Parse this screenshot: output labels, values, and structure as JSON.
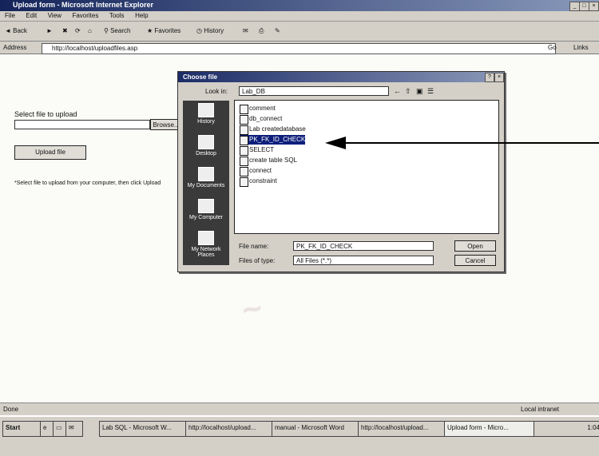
{
  "window": {
    "title": "Upload form - Microsoft Internet Explorer"
  },
  "menu": [
    "File",
    "Edit",
    "View",
    "Favorites",
    "Tools",
    "Help"
  ],
  "toolbar": {
    "back": "Back",
    "search": "Search",
    "favorites": "Favorites",
    "history": "History"
  },
  "address": {
    "label": "Address",
    "value": "http://localhost/uploadfiles.asp",
    "go": "Go",
    "links": "Links"
  },
  "page": {
    "select_label": "Select file to upload",
    "browse": "Browse...",
    "upload_button": "Upload file",
    "note": "*Select file to upload from your computer, then click Upload"
  },
  "dialog": {
    "title": "Choose file",
    "lookin_label": "Look in:",
    "lookin_value": "Lab_DB",
    "places": [
      "History",
      "Desktop",
      "My Documents",
      "My Computer",
      "My Network Places"
    ],
    "files": [
      "comment",
      "db_connect",
      "Lab createdatabase",
      "PK_FK_ID_CHECK",
      "SELECT",
      "create table SQL",
      "connect",
      "constraint"
    ],
    "filename_label": "File name:",
    "filename_value": "PK_FK_ID_CHECK",
    "filetype_label": "Files of type:",
    "filetype_value": "All Files (*.*)",
    "open": "Open",
    "cancel": "Cancel"
  },
  "status": {
    "left": "Done",
    "right": "Local intranet"
  },
  "taskbar": {
    "start": "Start",
    "tasks": [
      "Lab SQL - Microsoft W...",
      "http://localhost/upload...",
      "manual - Microsoft Word",
      "http://localhost/upload...",
      "Upload form - Micro..."
    ],
    "clock": "1:04"
  }
}
